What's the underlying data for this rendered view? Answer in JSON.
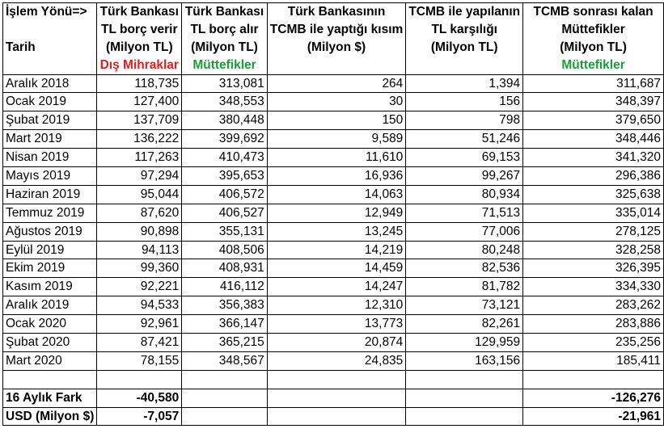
{
  "header": {
    "row1": [
      "İşlem Yönü=>",
      "Türk Bankası",
      "Türk Bankası",
      "Türk Bankasının",
      "TCMB ile yapılanın",
      "TCMB sonrası kalan"
    ],
    "row2": [
      "",
      "TL borç verir",
      "TL borç alır",
      "TCMB ile yaptığı kısım",
      "TL karşılığı",
      "Müttefikler"
    ],
    "row3": [
      "Tarih",
      "(Milyon TL)",
      "(Milyon TL)",
      "(Milyon $)",
      "(Milyon TL)",
      "(Milyon TL)"
    ],
    "row4": [
      "",
      "Dış Mihraklar",
      "Müttefikler",
      "",
      "",
      "Müttefikler"
    ]
  },
  "colors": {
    "red_label": "#e02020",
    "green_label": "#1e9a3c"
  },
  "rows": [
    [
      "Aralık 2018",
      "118,735",
      "313,081",
      "264",
      "1,394",
      "311,687"
    ],
    [
      "Ocak 2019",
      "127,400",
      "348,553",
      "30",
      "156",
      "348,397"
    ],
    [
      "Şubat 2019",
      "137,709",
      "380,448",
      "150",
      "798",
      "379,650"
    ],
    [
      "Mart 2019",
      "136,222",
      "399,692",
      "9,589",
      "51,246",
      "348,446"
    ],
    [
      "Nisan 2019",
      "117,263",
      "410,473",
      "11,610",
      "69,153",
      "341,320"
    ],
    [
      "Mayıs 2019",
      "97,294",
      "395,653",
      "16,936",
      "99,267",
      "296,386"
    ],
    [
      "Haziran 2019",
      "95,044",
      "406,572",
      "14,063",
      "80,934",
      "325,638"
    ],
    [
      "Temmuz 2019",
      "87,620",
      "406,527",
      "12,949",
      "71,513",
      "335,014"
    ],
    [
      "Ağustos 2019",
      "90,898",
      "355,131",
      "13,245",
      "77,006",
      "278,125"
    ],
    [
      "Eylül 2019",
      "94,113",
      "408,506",
      "14,219",
      "80,248",
      "328,258"
    ],
    [
      "Ekim 2019",
      "99,360",
      "408,931",
      "14,459",
      "82,536",
      "326,395"
    ],
    [
      "Kasım 2019",
      "92,221",
      "416,112",
      "14,247",
      "81,782",
      "334,330"
    ],
    [
      "Aralık 2019",
      "94,533",
      "356,383",
      "12,310",
      "73,121",
      "283,262"
    ],
    [
      "Ocak 2020",
      "92,961",
      "366,147",
      "13,773",
      "82,261",
      "283,886"
    ],
    [
      "Şubat 2020",
      "87,421",
      "365,215",
      "20,874",
      "129,959",
      "235,256"
    ],
    [
      "Mart 2020",
      "78,155",
      "348,567",
      "24,835",
      "163,156",
      "185,411"
    ]
  ],
  "summary": [
    [
      "16 Aylık Fark",
      "-40,580",
      "",
      "",
      "",
      "-126,276"
    ],
    [
      "USD (Milyon $)",
      "-7,057",
      "",
      "",
      "",
      "-21,961"
    ]
  ]
}
